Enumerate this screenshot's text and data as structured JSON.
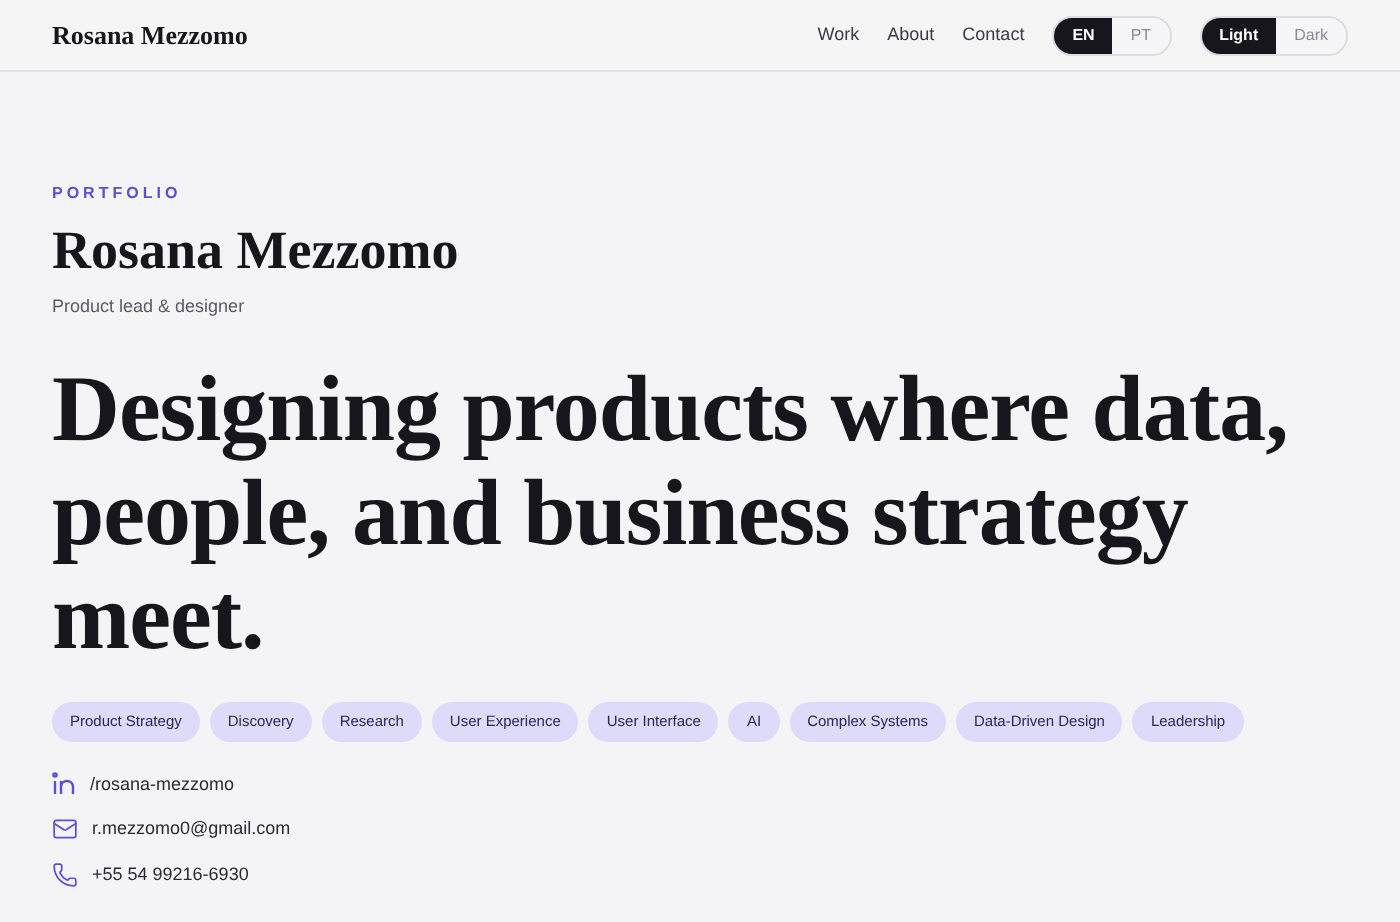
{
  "header": {
    "brand": "Rosana Mezzomo",
    "nav": [
      "Work",
      "About",
      "Contact"
    ],
    "languages": [
      {
        "label": "EN",
        "selected": true
      },
      {
        "label": "PT",
        "selected": false
      }
    ],
    "themes": [
      {
        "label": "Light",
        "selected": true
      },
      {
        "label": "Dark",
        "selected": false
      }
    ]
  },
  "hero": {
    "eyebrow": "PORTFOLIO",
    "name": "Rosana Mezzomo",
    "role": "Product lead & designer",
    "headline": "Designing products where data, people, and business strategy meet.",
    "tags": [
      "Product Strategy",
      "Discovery",
      "Research",
      "User Experience",
      "User Interface",
      "AI",
      "Complex Systems",
      "Data-Driven Design",
      "Leadership"
    ],
    "contacts": [
      {
        "kind": "linkedin",
        "text": "/rosana-mezzomo"
      },
      {
        "kind": "email",
        "text": "r.mezzomo0@gmail.com"
      },
      {
        "kind": "phone",
        "text": "+55 54 99216-6930"
      }
    ]
  }
}
